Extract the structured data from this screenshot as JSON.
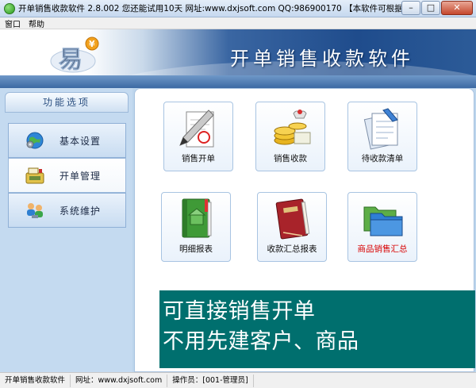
{
  "window": {
    "title": "开单销售收款软件   2.8.002  您还能试用10天   网址:www.dxjsoft.com   QQ:986900170   【本软件可根据您需求进行个性定",
    "minimize_label": "–",
    "maximize_label": "□",
    "close_label": "✕"
  },
  "menu": {
    "items": [
      {
        "label": "窗口"
      },
      {
        "label": "帮助"
      }
    ]
  },
  "banner": {
    "logo_char": "易",
    "logo_badge": "¥",
    "title": "开单销售收款软件"
  },
  "sidebar": {
    "header": "功能选项",
    "items": [
      {
        "label": "基本设置",
        "icon": "globe-gear-icon",
        "active": false
      },
      {
        "label": "开单管理",
        "icon": "cash-register-icon",
        "active": true
      },
      {
        "label": "系统维护",
        "icon": "people-network-icon",
        "active": false
      }
    ]
  },
  "tiles": [
    {
      "label": "销售开单",
      "icon": "pen-document-icon"
    },
    {
      "label": "销售收款",
      "icon": "coins-icon"
    },
    {
      "label": "待收款清单",
      "icon": "document-list-icon"
    },
    {
      "label": "明细报表",
      "icon": "green-book-icon"
    },
    {
      "label": "收款汇总报表",
      "icon": "red-book-icon"
    },
    {
      "label": "商品销售汇总",
      "icon": "folder-icon",
      "highlight_color": "#d80000"
    }
  ],
  "promo": {
    "line1": "可直接销售开单",
    "line2": "不用先建客户、商品",
    "background": "#006f6e"
  },
  "status": {
    "app_name": "开单销售收款软件",
    "website": "网址：www.dxjsoft.com",
    "operator": "操作员：[001-管理员]"
  }
}
